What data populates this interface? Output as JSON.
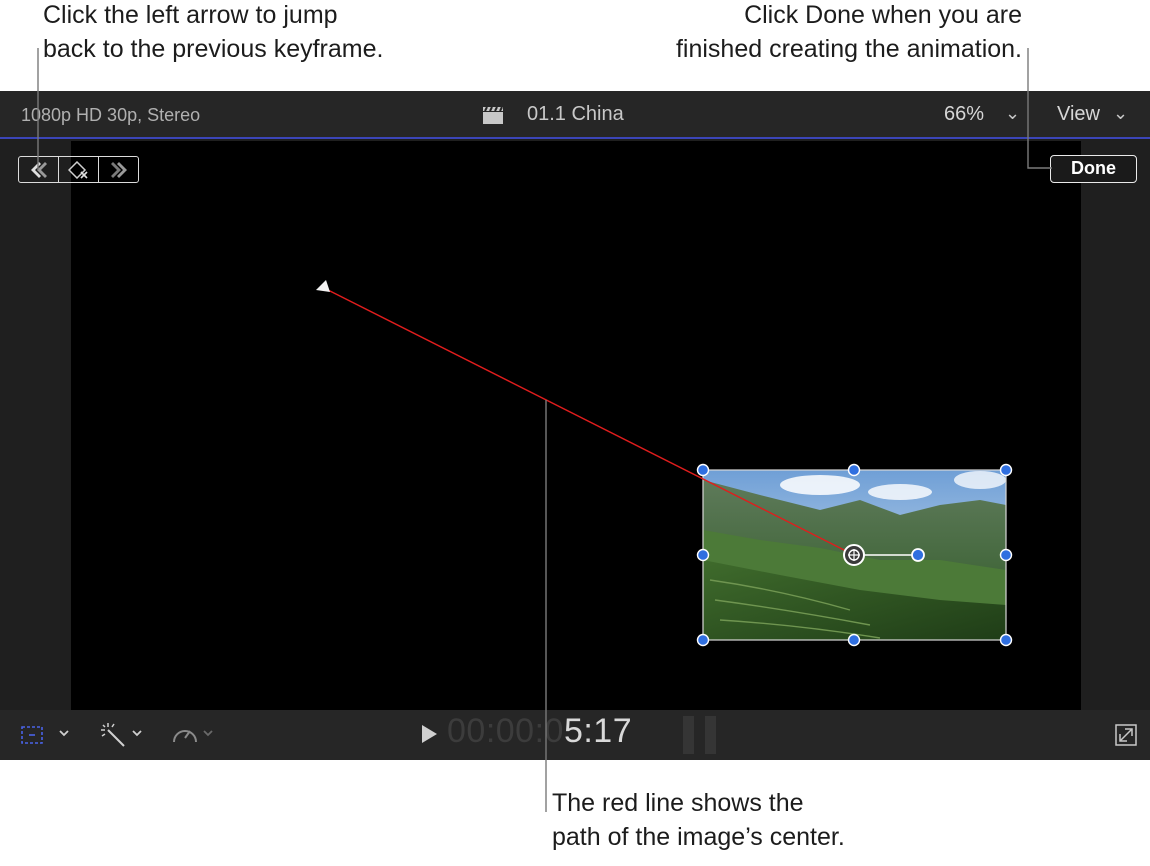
{
  "callouts": {
    "left_line1": "Click the left arrow to jump",
    "left_line2": "back to the previous keyframe.",
    "right_line1": "Click Done when you are",
    "right_line2": "finished creating the animation.",
    "bottom_line1": "The red line shows the",
    "bottom_line2": "path of the image’s center."
  },
  "viewer": {
    "format": "1080p HD 30p, Stereo",
    "clip_name": "01.1 China",
    "zoom": "66%",
    "zoom_chevron": "⌄",
    "view_label": "View",
    "view_chevron": "⌄",
    "done_label": "Done"
  },
  "timecode": {
    "dim": "00:00:0",
    "bright": "5:17"
  },
  "icons": {
    "prev_keyframe": "prev-keyframe-icon",
    "delete_keyframe": "delete-keyframe-icon",
    "next_keyframe": "next-keyframe-icon",
    "clip": "clapper-icon",
    "transform": "transform-icon",
    "enhance": "magic-wand-icon",
    "retime": "speedometer-icon",
    "fullscreen": "fullscreen-icon",
    "play": "play-icon"
  },
  "colors": {
    "accent_blue": "#3b45b8",
    "path_red": "#e01d1d",
    "handle_blue": "#2f6fe0"
  }
}
